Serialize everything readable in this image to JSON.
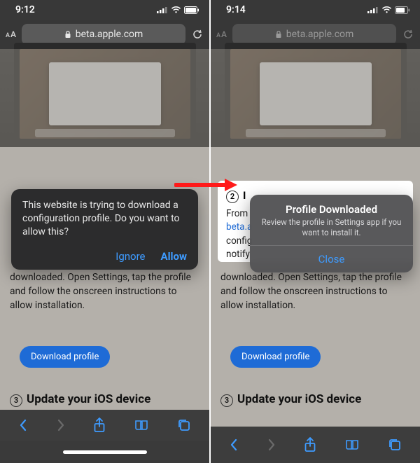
{
  "left": {
    "time": "9:12",
    "url": "beta.apple.com",
    "popup": {
      "message": "This website is trying to download a configuration profile. Do you want to allow this?",
      "ignore": "Ignore",
      "allow": "Allow"
    },
    "under_text": "downloaded. Open Settings, tap the profile and follow the onscreen instructions to allow installation.",
    "download_btn": "Download profile",
    "heading3_num": "3",
    "heading3": "Update your iOS device"
  },
  "right": {
    "time": "9:14",
    "url": "beta.apple.com",
    "step2_num": "2",
    "step2_title": "I",
    "step2_body_prefix": "From ",
    "step2_link": "beta.a",
    "step2_line3": "config",
    "step2_line4": "notify",
    "popup": {
      "title": "Profile Downloaded",
      "subtitle": "Review the profile in Settings app if you want to install it.",
      "close": "Close"
    },
    "under_text": "downloaded. Open Settings, tap the profile and follow the onscreen instructions to allow installation.",
    "download_btn": "Download profile",
    "heading3_num": "3",
    "heading3": "Update your iOS device"
  }
}
